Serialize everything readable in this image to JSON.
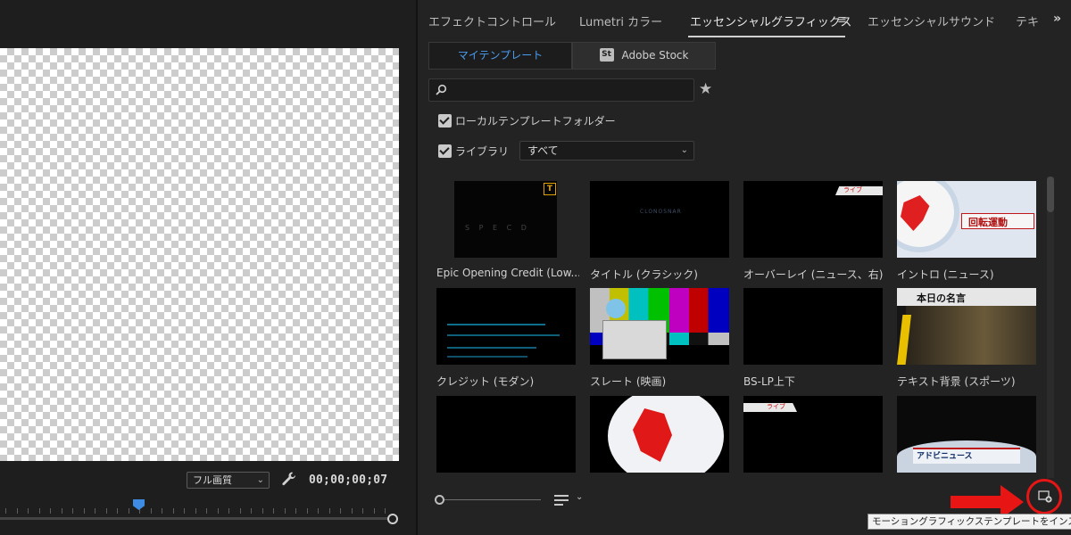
{
  "monitor": {
    "quality": "フル画質",
    "timecode": "00;00;00;07"
  },
  "tabs": [
    {
      "label": "エフェクトコントロール"
    },
    {
      "label": "Lumetri カラー"
    },
    {
      "label": "エッセンシャルグラフィックス"
    },
    {
      "label": "エッセンシャルサウンド"
    },
    {
      "label": "テキ"
    }
  ],
  "active_tab": "エッセンシャルグラフィックス",
  "source_tabs": {
    "my_templates": "マイテンプレート",
    "adobe_stock": "Adobe Stock",
    "stock_badge": "St"
  },
  "search": {
    "placeholder": ""
  },
  "filters": {
    "local_folder": "ローカルテンプレートフォルダー",
    "library": "ライブラリ",
    "library_value": "すべて"
  },
  "templates": [
    {
      "caption": "Epic Opening Credit (Low...",
      "thumb_text": "S P E C D"
    },
    {
      "caption": "タイトル (クラシック)",
      "thumb_text": "CLONOSNAR"
    },
    {
      "caption": "オーバーレイ (ニュース、右)",
      "thumb_text": "ライブ"
    },
    {
      "caption": "イントロ (ニュース)",
      "thumb_text": "回転運動"
    },
    {
      "caption": "クレジット (モダン)",
      "thumb_text": ""
    },
    {
      "caption": "スレート (映画)",
      "thumb_text": ""
    },
    {
      "caption": "BS-LP上下",
      "thumb_text": ""
    },
    {
      "caption": "テキスト背景 (スポーツ)",
      "thumb_text": "本日の名言"
    },
    {
      "caption": "",
      "thumb_text": ""
    },
    {
      "caption": "",
      "thumb_text": ""
    },
    {
      "caption": "",
      "thumb_text": "ライブ"
    },
    {
      "caption": "",
      "thumb_text": "アドビニュース"
    }
  ],
  "tooltip": "モーショングラフィックステンプレートをインストール",
  "colors": {
    "accent": "#4a9df0",
    "highlight": "#e81515",
    "playhead": "#3e8be4"
  }
}
